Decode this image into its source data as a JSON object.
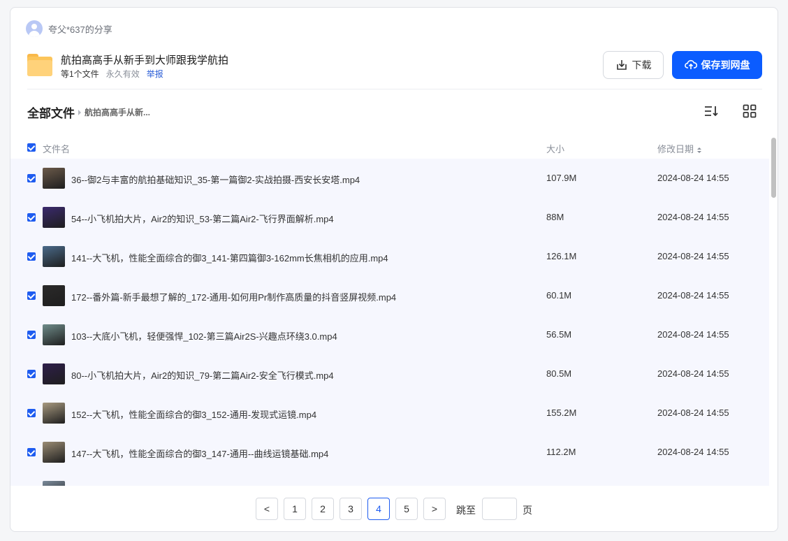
{
  "share": {
    "sharer_name": "夸父*637的分享",
    "title": "航拍高高手从新手到大师跟我学航拍",
    "file_count": "等1个文件",
    "validity": "永久有效",
    "report": "举报",
    "download_label": "下载",
    "save_label": "保存到网盘"
  },
  "breadcrumb": {
    "root": "全部文件",
    "current": "航拍高高手从新..."
  },
  "table": {
    "col_name": "文件名",
    "col_size": "大小",
    "col_date": "修改日期",
    "rows": [
      {
        "name": "36--御2与丰富的航拍基础知识_35-第一篇御2-实战拍摄-西安长安塔.mp4",
        "size": "107.9M",
        "date": "2024-08-24 14:55",
        "thumb": "#6b5a4a"
      },
      {
        "name": "54--小飞机拍大片，Air2的知识_53-第二篇Air2-飞行界面解析.mp4",
        "size": "88M",
        "date": "2024-08-24 14:55",
        "thumb": "#3b2a6e"
      },
      {
        "name": "141--大飞机，性能全面综合的御3_141-第四篇御3-162mm长焦相机的应用.mp4",
        "size": "126.1M",
        "date": "2024-08-24 14:55",
        "thumb": "#4a6a8a"
      },
      {
        "name": "172--番外篇-新手最想了解的_172-通用-如何用Pr制作高质量的抖音竖屏视频.mp4",
        "size": "60.1M",
        "date": "2024-08-24 14:55",
        "thumb": "#2b2a2a"
      },
      {
        "name": "103--大底小飞机，轻便强悍_102-第三篇Air2S-兴趣点环绕3.0.mp4",
        "size": "56.5M",
        "date": "2024-08-24 14:55",
        "thumb": "#6f8c8a"
      },
      {
        "name": "80--小飞机拍大片，Air2的知识_79-第二篇Air2-安全飞行模式.mp4",
        "size": "80.5M",
        "date": "2024-08-24 14:55",
        "thumb": "#2e1f4a"
      },
      {
        "name": "152--大飞机，性能全面综合的御3_152-通用-发现式运镜.mp4",
        "size": "155.2M",
        "date": "2024-08-24 14:55",
        "thumb": "#a89a80"
      },
      {
        "name": "147--大飞机，性能全面综合的御3_147-通用--曲线运镜基础.mp4",
        "size": "112.2M",
        "date": "2024-08-24 14:55",
        "thumb": "#9a8c74"
      },
      {
        "name": "",
        "size": "",
        "date": "",
        "thumb": "#7a8a9a"
      }
    ]
  },
  "pagination": {
    "prev": "<",
    "pages": [
      "1",
      "2",
      "3",
      "4",
      "5"
    ],
    "current_page": "4",
    "next": ">",
    "jump_label": "跳至",
    "jump_unit": "页",
    "jump_value": ""
  },
  "colors": {
    "primary": "#0b5cff",
    "row_bg": "#f6f7fe",
    "folder": "#fcc55a"
  }
}
